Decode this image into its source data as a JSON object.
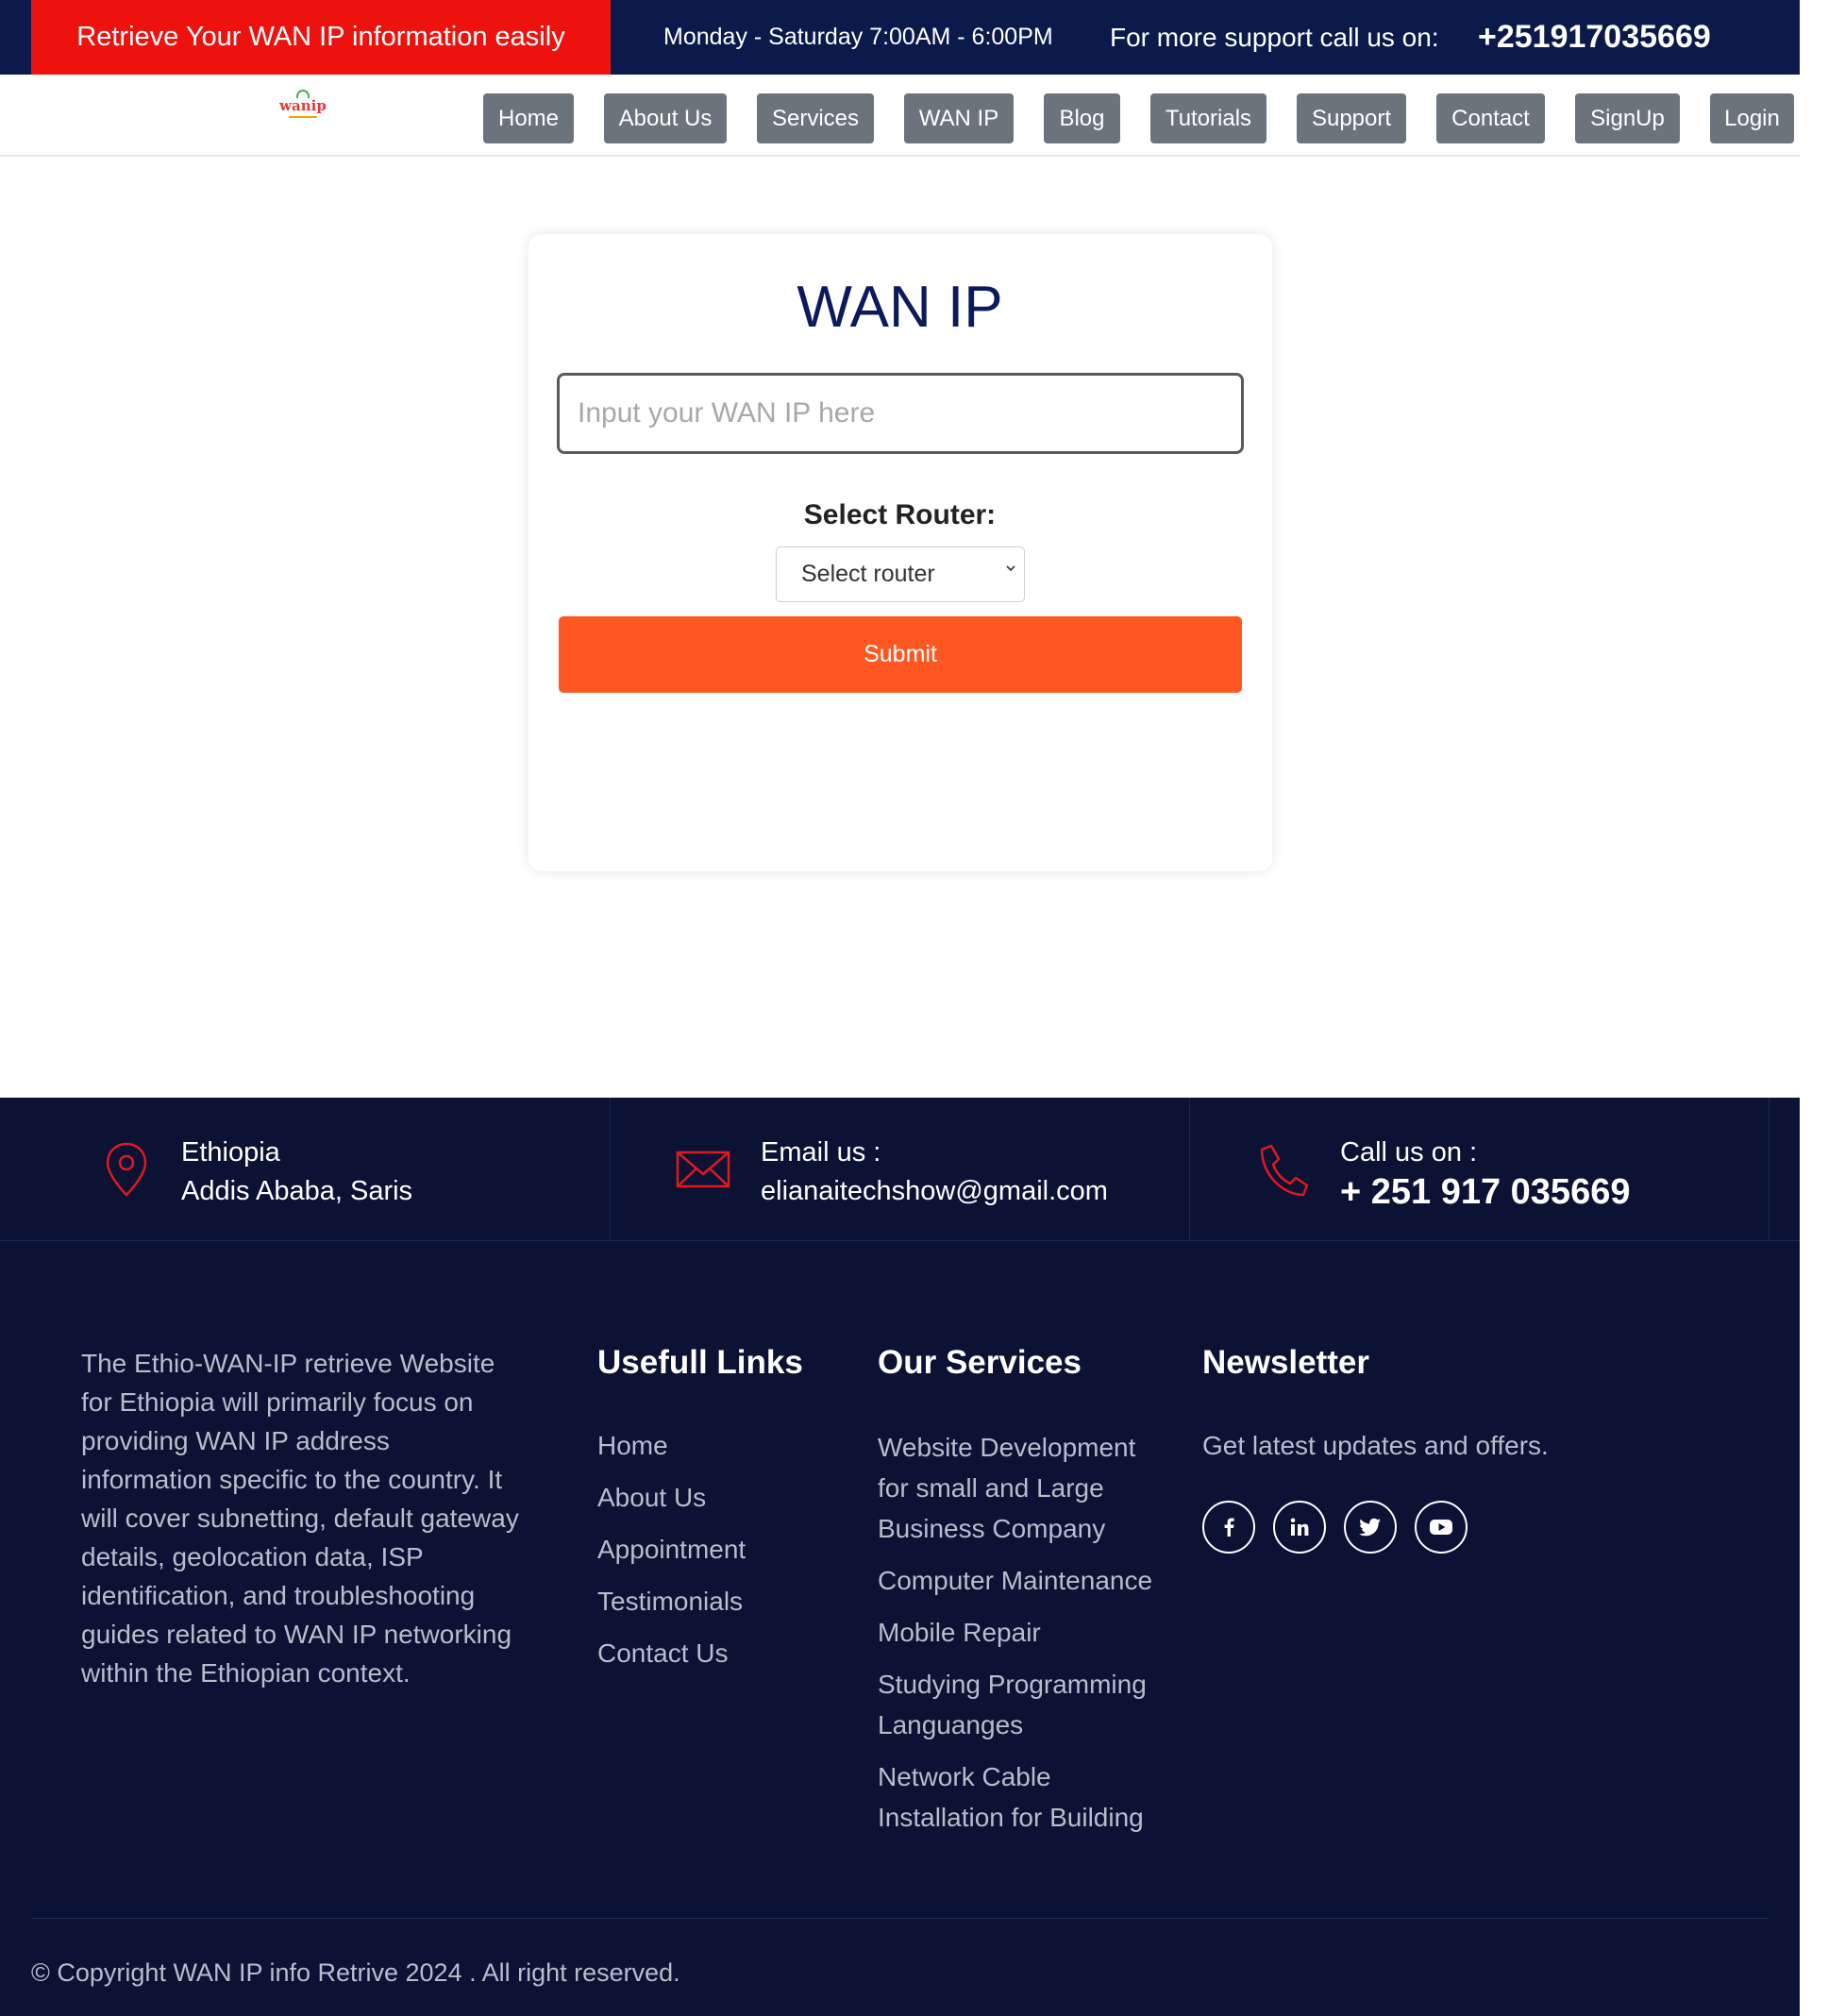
{
  "topbar": {
    "tagline": "Retrieve Your WAN IP information easily",
    "hours": "Monday - Saturday 7:00AM - 6:00PM",
    "support_label": "For more support call us on:",
    "phone": "+251917035669"
  },
  "logo": {
    "text": "wanip"
  },
  "nav": {
    "items": [
      {
        "label": "Home"
      },
      {
        "label": "About Us"
      },
      {
        "label": "Services"
      },
      {
        "label": "WAN IP"
      },
      {
        "label": "Blog"
      },
      {
        "label": "Tutorials"
      },
      {
        "label": "Support"
      },
      {
        "label": "Contact"
      },
      {
        "label": "SignUp"
      },
      {
        "label": "Login"
      }
    ]
  },
  "form": {
    "title": "WAN IP",
    "input_placeholder": "Input your WAN IP here",
    "input_value": "",
    "router_label": "Select Router:",
    "router_selected": "Select router",
    "submit_label": "Submit"
  },
  "contact": {
    "location_line1": "Ethiopia",
    "location_line2": "Addis Ababa, Saris",
    "email_label": "Email us :",
    "email": "elianaitechshow@gmail.com",
    "call_label": "Call us on :",
    "call_number": "+ 251 917 035669"
  },
  "footer": {
    "about": "The Ethio-WAN-IP retrieve Website for Ethiopia will primarily focus on providing WAN IP address information specific to the country. It will cover subnetting, default gateway details, geolocation data, ISP identification, and troubleshooting guides related to WAN IP networking within the Ethiopian context.",
    "links_heading": "Usefull Links",
    "links": [
      "Home",
      "About Us",
      "Appointment",
      "Testimonials",
      "Contact Us"
    ],
    "services_heading": "Our Services",
    "services": [
      "Website Development for small and Large Business Company",
      "Computer Maintenance",
      "Mobile Repair",
      "Studying Programming Languanges",
      "Network Cable Installation for Building"
    ],
    "newsletter_heading": "Newsletter",
    "newsletter_text": "Get latest updates and offers.",
    "social_icons": [
      "facebook-icon",
      "linkedin-icon",
      "twitter-icon",
      "youtube-icon"
    ],
    "copyright": "© Copyright WAN IP info Retrive 2024 . All right reserved."
  },
  "colors": {
    "topbar_bg": "#0b1a4a",
    "tagline_bg": "#ee120f",
    "nav_button": "#6b747c",
    "title": "#0b1a5c",
    "submit": "#ff5722",
    "footer_bg": "#0b1234",
    "icon_red": "#e0191c"
  }
}
